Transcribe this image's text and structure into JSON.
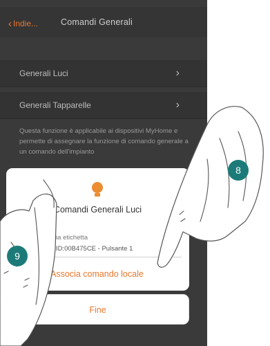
{
  "header": {
    "back_label": "Indie...",
    "back_icon": "chevron-left-icon",
    "title": "Comandi Generali"
  },
  "list": [
    {
      "label": "Generali Luci"
    },
    {
      "label": "Generali Tapparelle"
    }
  ],
  "description": "Questa funzione è applicabile ai dispositivi MyHome e permette di assegnare la funzione di comando generale a un comando dell'impianto",
  "dialog": {
    "icon": "lightbulb-icon",
    "title": "Comandi Generali Luci",
    "field_label": "Una etichetta",
    "field_value": "62/2 - ID:00B475CE - Pulsante 1",
    "associate_label": "Associa comando locale"
  },
  "done_button": "Fine",
  "badges": {
    "left": "9",
    "right": "8"
  },
  "colors": {
    "accent": "#e8772e",
    "badge": "#1c7b78",
    "background": "#3a3a3a"
  }
}
